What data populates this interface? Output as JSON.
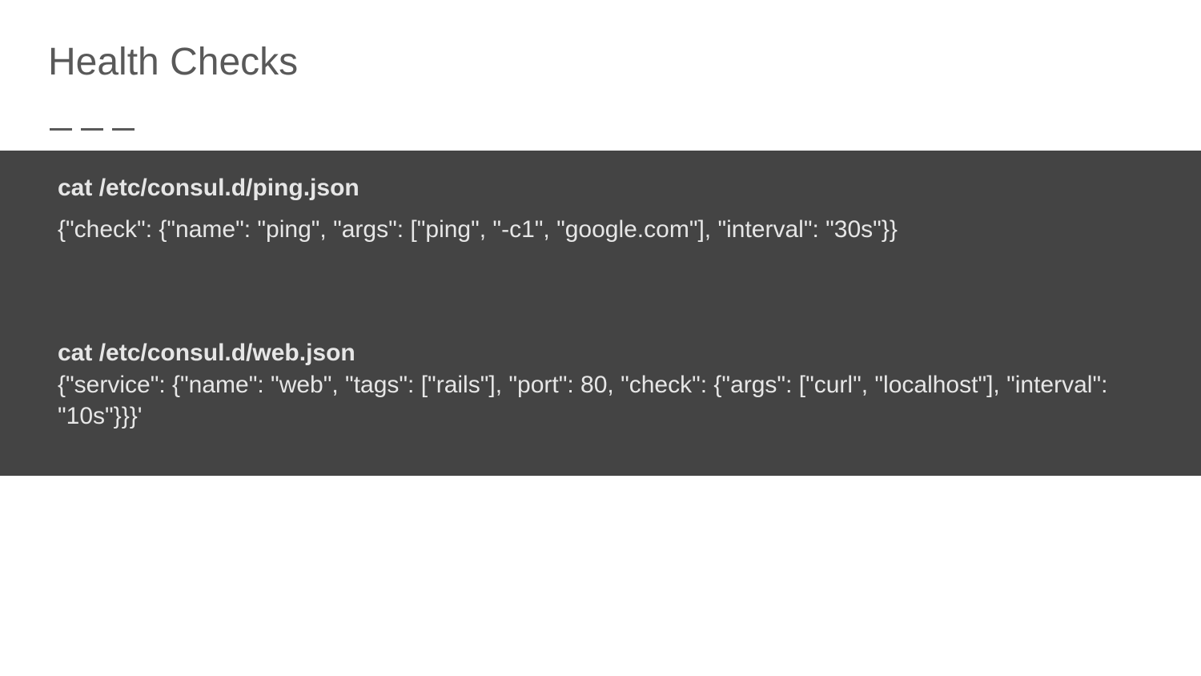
{
  "title": "Health Checks",
  "block": {
    "cmd1": "cat  /etc/consul.d/ping.json",
    "json1": "{\"check\": {\"name\": \"ping\",  \"args\": [\"ping\", \"-c1\", \"google.com\"], \"interval\": \"30s\"}}",
    "cmd2": " cat /etc/consul.d/web.json",
    "json2": "{\"service\": {\"name\": \"web\", \"tags\": [\"rails\"], \"port\": 80,  \"check\": {\"args\": [\"curl\", \"localhost\"], \"interval\": \"10s\"}}}'"
  }
}
